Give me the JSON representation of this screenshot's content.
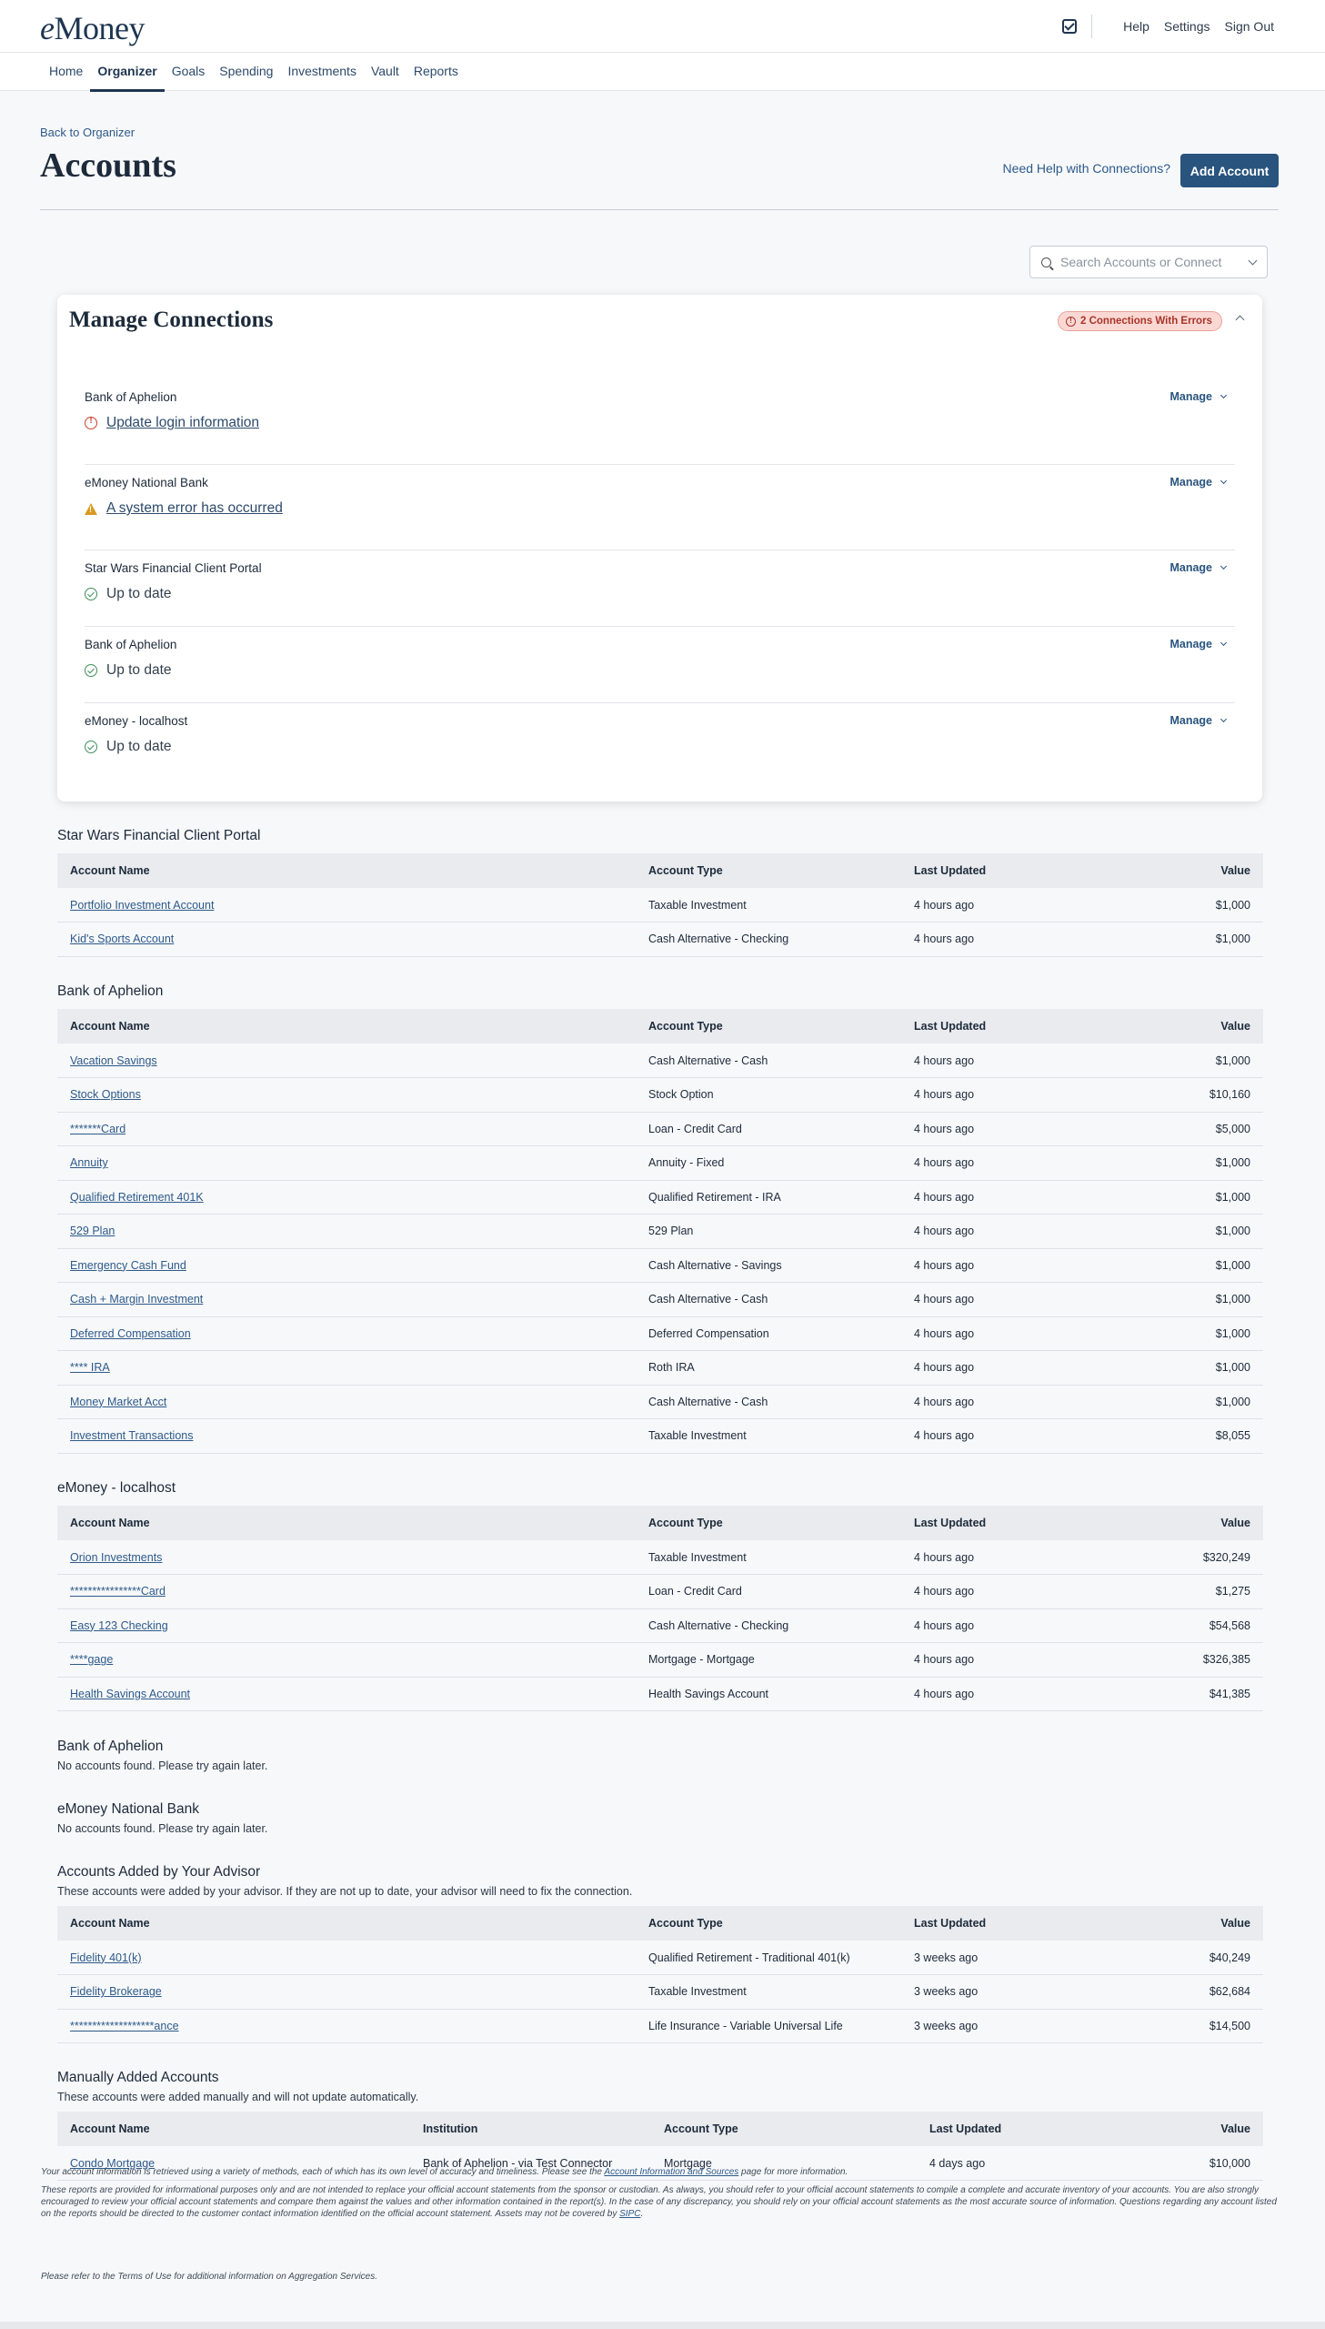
{
  "header": {
    "logo": "eMoney",
    "links": [
      "Help",
      "Settings",
      "Sign Out"
    ]
  },
  "nav": {
    "items": [
      "Home",
      "Organizer",
      "Goals",
      "Spending",
      "Investments",
      "Vault",
      "Reports"
    ],
    "active": "Organizer"
  },
  "page": {
    "back_label": "Back to Organizer",
    "title": "Accounts",
    "help_label": "Need Help with Connections?",
    "add_label": "Add Account",
    "search_placeholder": "Search Accounts or Connect"
  },
  "connections": {
    "title": "Manage Connections",
    "badge": "2 Connections With Errors",
    "manage_label": "Manage",
    "items": [
      {
        "name": "Bank of Aphelion",
        "status": "Update login information",
        "kind": "error"
      },
      {
        "name": "eMoney National Bank",
        "status": "A system error has occurred",
        "kind": "warning"
      },
      {
        "name": "Star Wars Financial Client Portal",
        "status": "Up to date",
        "kind": "ok"
      },
      {
        "name": "Bank of Aphelion",
        "status": "Up to date",
        "kind": "ok"
      },
      {
        "name": "eMoney - localhost",
        "status": "Up to date",
        "kind": "ok"
      }
    ]
  },
  "table_headers": {
    "name": "Account Name",
    "institution": "Institution",
    "type": "Account Type",
    "updated": "Last Updated",
    "value": "Value"
  },
  "sections": [
    {
      "title": "Star Wars Financial Client Portal",
      "rows": [
        [
          "Portfolio Investment Account",
          "Taxable Investment",
          "4 hours ago",
          "$1,000"
        ],
        [
          "Kid's Sports Account",
          "Cash Alternative - Checking",
          "4 hours ago",
          "$1,000"
        ]
      ]
    },
    {
      "title": "Bank of Aphelion",
      "rows": [
        [
          "Vacation Savings",
          "Cash Alternative - Cash",
          "4 hours ago",
          "$1,000"
        ],
        [
          "Stock Options",
          "Stock Option",
          "4 hours ago",
          "$10,160"
        ],
        [
          "*******Card",
          "Loan - Credit Card",
          "4 hours ago",
          "$5,000"
        ],
        [
          "Annuity",
          "Annuity - Fixed",
          "4 hours ago",
          "$1,000"
        ],
        [
          "Qualified Retirement 401K",
          "Qualified Retirement - IRA",
          "4 hours ago",
          "$1,000"
        ],
        [
          "529 Plan",
          "529 Plan",
          "4 hours ago",
          "$1,000"
        ],
        [
          "Emergency Cash Fund",
          "Cash Alternative - Savings",
          "4 hours ago",
          "$1,000"
        ],
        [
          "Cash + Margin Investment",
          "Cash Alternative - Cash",
          "4 hours ago",
          "$1,000"
        ],
        [
          "Deferred Compensation",
          "Deferred Compensation",
          "4 hours ago",
          "$1,000"
        ],
        [
          "**** IRA",
          "Roth IRA",
          "4 hours ago",
          "$1,000"
        ],
        [
          "Money Market Acct",
          "Cash Alternative - Cash",
          "4 hours ago",
          "$1,000"
        ],
        [
          "Investment Transactions",
          "Taxable Investment",
          "4 hours ago",
          "$8,055"
        ]
      ]
    },
    {
      "title": "eMoney - localhost",
      "rows": [
        [
          "Orion Investments",
          "Taxable Investment",
          "4 hours ago",
          "$320,249"
        ],
        [
          "****************Card",
          "Loan - Credit Card",
          "4 hours ago",
          "$1,275"
        ],
        [
          "Easy 123 Checking",
          "Cash Alternative - Checking",
          "4 hours ago",
          "$54,568"
        ],
        [
          "****gage",
          "Mortgage - Mortgage",
          "4 hours ago",
          "$326,385"
        ],
        [
          "Health Savings Account",
          "Health Savings Account",
          "4 hours ago",
          "$41,385"
        ]
      ]
    }
  ],
  "empty_sections": [
    {
      "title": "Bank of Aphelion",
      "message": "No accounts found. Please try again later."
    },
    {
      "title": "eMoney National Bank",
      "message": "No accounts found. Please try again later."
    }
  ],
  "advisor_section": {
    "title": "Accounts Added by Your Advisor",
    "note": "These accounts were added by your advisor. If they are not up to date, your advisor will need to fix the connection.",
    "rows": [
      [
        "Fidelity 401(k)",
        "Qualified Retirement - Traditional 401(k)",
        "3 weeks ago",
        "$40,249"
      ],
      [
        "Fidelity Brokerage",
        "Taxable Investment",
        "3 weeks ago",
        "$62,684"
      ],
      [
        "*******************ance",
        "Life Insurance - Variable Universal Life",
        "3 weeks ago",
        "$14,500"
      ]
    ]
  },
  "manual_section": {
    "title": "Manually Added Accounts",
    "note": "These accounts were added manually and will not update automatically.",
    "rows": [
      [
        "Condo Mortgage",
        "Bank of Aphelion - via Test Connector",
        "Mortgage",
        "4 days ago",
        "$10,000"
      ]
    ]
  },
  "footer": {
    "line1_pre": "Your account information is retrieved using a variety of methods, each of which has its own level of accuracy and timeliness. Please see the ",
    "line1_link": "Account Information and Sources",
    "line1_post": " page for more information.",
    "line2_pre": "These reports are provided for informational purposes only and are not intended to replace your official account statements from the sponsor or custodian. As always, you should refer to your official account statements to compile a complete and accurate inventory of your accounts. You are also strongly encouraged to review your official account statements and compare them against the values and other information contained in the report(s). In the case of any discrepancy, you should rely on your official account statements as the most accurate source of information. Questions regarding any account listed on the reports should be directed to the customer contact information identified on the official account statement. Assets may not be covered by ",
    "line2_link": "SIPC",
    "line2_post": ".",
    "line3": "Please refer to the Terms of Use for additional information on Aggregation Services."
  }
}
